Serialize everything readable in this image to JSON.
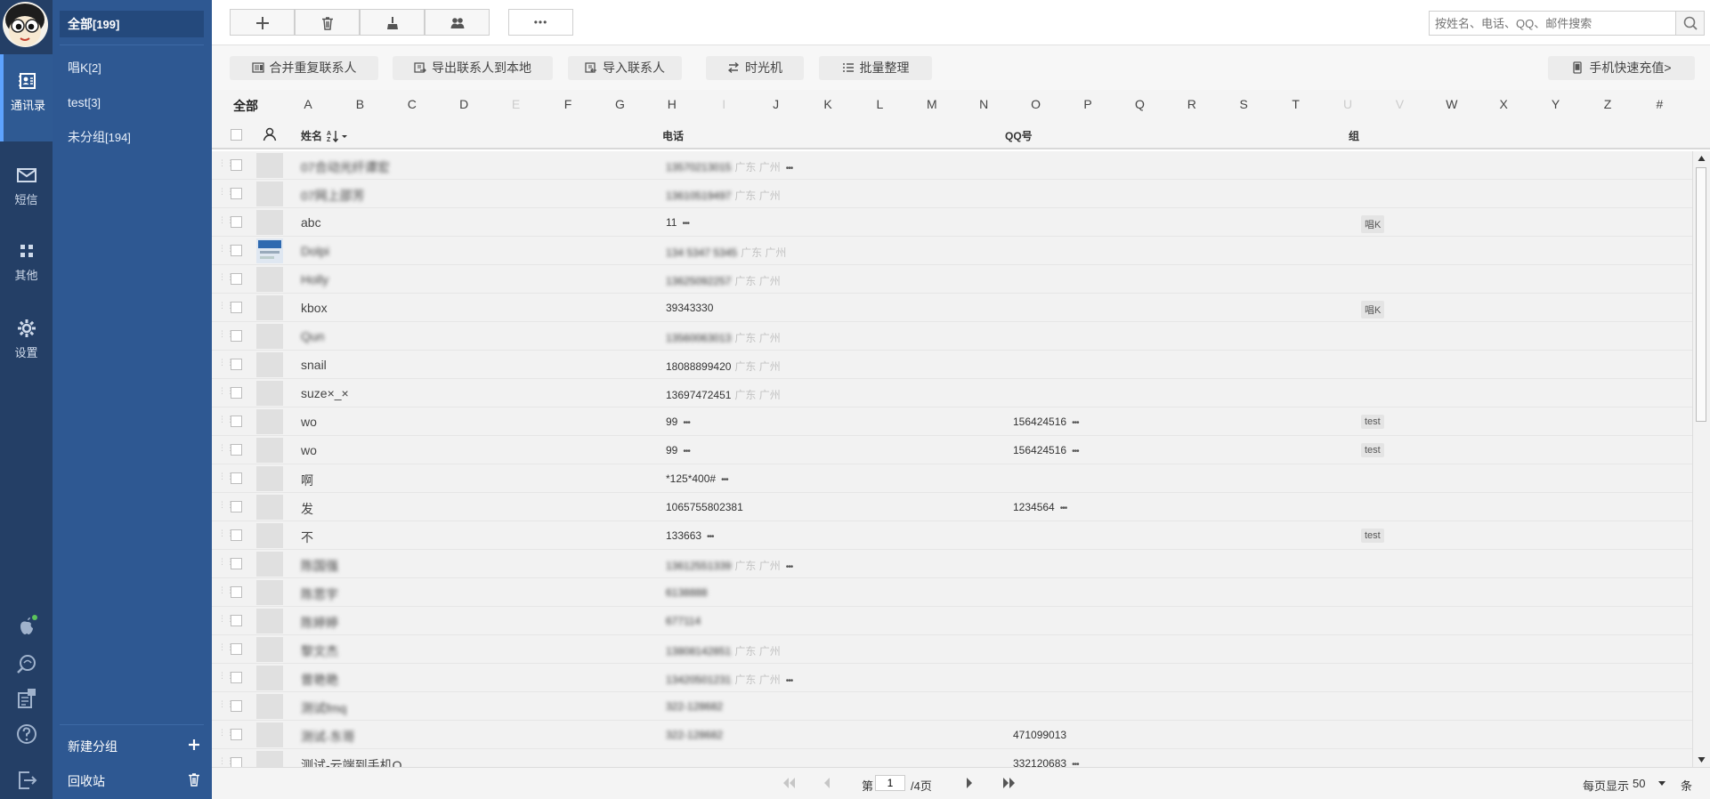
{
  "rail": {
    "items": [
      {
        "label": "通讯录",
        "icon": "contacts-icon",
        "active": true
      },
      {
        "label": "短信",
        "icon": "mail-icon",
        "active": false
      },
      {
        "label": "其他",
        "icon": "grid-icon",
        "active": false
      },
      {
        "label": "设置",
        "icon": "gear-icon",
        "active": false
      }
    ],
    "bottom_icons": [
      "apple-icon",
      "sync-icon",
      "notes-icon",
      "help-icon",
      "logout-icon"
    ]
  },
  "sidebar": {
    "groups": [
      {
        "label": "全部",
        "count": "[199]",
        "active": true
      },
      {
        "label": "唱K",
        "count": "[2]",
        "active": false
      },
      {
        "label": "test",
        "count": "[3]",
        "active": false
      },
      {
        "label": "未分组",
        "count": "[194]",
        "active": false
      }
    ],
    "new_group_label": "新建分组",
    "recycle_label": "回收站"
  },
  "toolbar": {
    "buttons": [
      "plus-icon",
      "trash-icon",
      "broom-icon",
      "people-icon"
    ],
    "more_label": "•••",
    "search_placeholder": "按姓名、电话、QQ、邮件搜索"
  },
  "actions": {
    "merge": "合并重复联系人",
    "export": "导出联系人到本地",
    "import": "导入联系人",
    "timemachine": "时光机",
    "batch": "批量整理",
    "recharge": "手机快速充值>"
  },
  "letters": {
    "all": "全部",
    "items": [
      {
        "l": "A",
        "dim": false
      },
      {
        "l": "B",
        "dim": false
      },
      {
        "l": "C",
        "dim": false
      },
      {
        "l": "D",
        "dim": false
      },
      {
        "l": "E",
        "dim": true
      },
      {
        "l": "F",
        "dim": false
      },
      {
        "l": "G",
        "dim": false
      },
      {
        "l": "H",
        "dim": false
      },
      {
        "l": "I",
        "dim": true
      },
      {
        "l": "J",
        "dim": false
      },
      {
        "l": "K",
        "dim": false
      },
      {
        "l": "L",
        "dim": false
      },
      {
        "l": "M",
        "dim": false
      },
      {
        "l": "N",
        "dim": false
      },
      {
        "l": "O",
        "dim": false
      },
      {
        "l": "P",
        "dim": false
      },
      {
        "l": "Q",
        "dim": false
      },
      {
        "l": "R",
        "dim": false
      },
      {
        "l": "S",
        "dim": false
      },
      {
        "l": "T",
        "dim": false
      },
      {
        "l": "U",
        "dim": true
      },
      {
        "l": "V",
        "dim": true
      },
      {
        "l": "W",
        "dim": false
      },
      {
        "l": "X",
        "dim": false
      },
      {
        "l": "Y",
        "dim": false
      },
      {
        "l": "Z",
        "dim": false
      },
      {
        "l": "#",
        "dim": false
      }
    ]
  },
  "table": {
    "headers": {
      "name": "姓名",
      "phone": "电话",
      "qq": "QQ号",
      "group": "组"
    },
    "rows": [
      {
        "name": "07合动光纤谭宏",
        "phone": "13570213015",
        "loc": "广东 广州",
        "more": true,
        "qq": "",
        "group": "",
        "blur": true
      },
      {
        "name": "07网上邵芳",
        "phone": "13610519497",
        "loc": "广东 广州",
        "more": false,
        "qq": "",
        "group": "",
        "blur": true
      },
      {
        "name": "abc",
        "phone": "11",
        "loc": "",
        "more": true,
        "qq": "",
        "group": "唱K",
        "blur": false
      },
      {
        "name": "Dolpi",
        "phone": "134 5347 5345",
        "loc": "广东 广州",
        "more": false,
        "qq": "",
        "group": "",
        "blur": true,
        "photo": true
      },
      {
        "name": "Holly",
        "phone": "13625092257",
        "loc": "广东 广州",
        "more": false,
        "qq": "",
        "group": "",
        "blur": true
      },
      {
        "name": "kbox",
        "phone": "39343330",
        "loc": "",
        "more": false,
        "qq": "",
        "group": "唱K",
        "blur": false
      },
      {
        "name": "Qun",
        "phone": "13560063013",
        "loc": "广东 广州",
        "more": false,
        "qq": "",
        "group": "",
        "blur": true
      },
      {
        "name": "snail",
        "phone": "18088899420",
        "loc": "广东 广州",
        "more": false,
        "qq": "",
        "group": "",
        "blur": false
      },
      {
        "name": "suze×_×",
        "phone": "13697472451",
        "loc": "广东 广州",
        "more": false,
        "qq": "",
        "group": "",
        "blur": false
      },
      {
        "name": "wo",
        "phone": "99",
        "loc": "",
        "more": true,
        "qq": "156424516",
        "qqmore": true,
        "group": "test",
        "blur": false
      },
      {
        "name": "wo",
        "phone": "99",
        "loc": "",
        "more": true,
        "qq": "156424516",
        "qqmore": true,
        "group": "test",
        "blur": false
      },
      {
        "name": "啊",
        "phone": "*125*400#",
        "loc": "",
        "more": true,
        "qq": "",
        "group": "",
        "blur": false
      },
      {
        "name": "发",
        "phone": "1065755802381",
        "loc": "",
        "more": false,
        "qq": "1234564",
        "qqmore": true,
        "group": "",
        "blur": false
      },
      {
        "name": "不",
        "phone": "133663",
        "loc": "",
        "more": true,
        "qq": "",
        "group": "test",
        "blur": false
      },
      {
        "name": "陈国强",
        "phone": "13612551339",
        "loc": "广东 广州",
        "more": true,
        "qq": "",
        "group": "",
        "blur": true
      },
      {
        "name": "陈思宇",
        "phone": "6138888",
        "loc": "",
        "more": false,
        "qq": "",
        "group": "",
        "blur": true
      },
      {
        "name": "陈婷婷",
        "phone": "677114",
        "loc": "",
        "more": false,
        "qq": "",
        "group": "",
        "blur": true
      },
      {
        "name": "黎文杰",
        "phone": "13808142851",
        "loc": "广东 广州",
        "more": false,
        "qq": "",
        "group": "",
        "blur": true
      },
      {
        "name": "曾艳艳",
        "phone": "13420501231",
        "loc": "广东 广州",
        "more": true,
        "qq": "",
        "group": "",
        "blur": true
      },
      {
        "name": "测试fmq",
        "phone": "322-128682",
        "loc": "",
        "more": false,
        "qq": "",
        "group": "",
        "blur": true
      },
      {
        "name": "测试-东哥",
        "phone": "322-128682",
        "loc": "",
        "more": false,
        "qq": "471099013",
        "qqmore": false,
        "group": "",
        "blur": true
      },
      {
        "name": "测试-云端到手机Q",
        "phone": "",
        "loc": "",
        "more": false,
        "qq": "332120683",
        "qqmore": true,
        "group": "",
        "blur": false
      }
    ]
  },
  "pager": {
    "prefix": "第",
    "page": "1",
    "suffix": "/4页",
    "per_page_label": "每页显示",
    "per_page": "50",
    "unit": "条"
  }
}
